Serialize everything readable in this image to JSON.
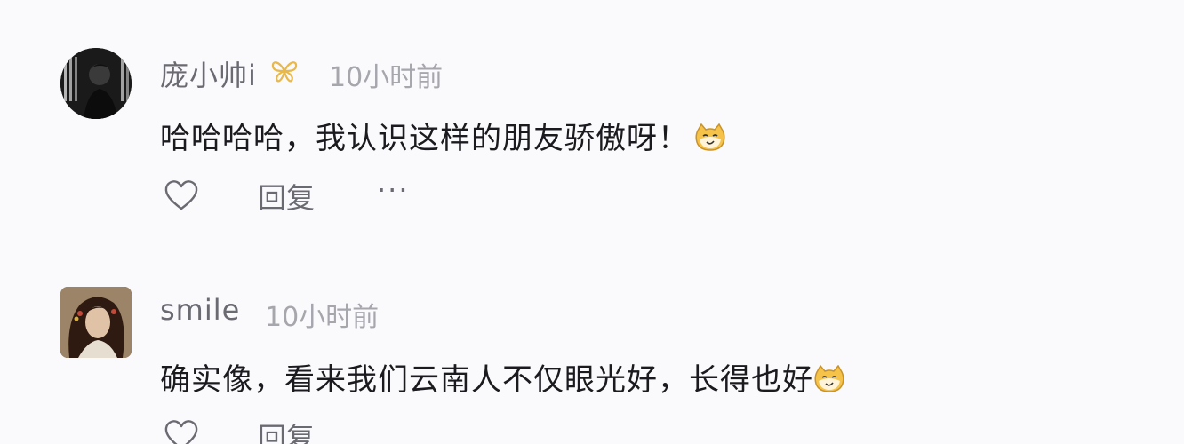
{
  "comments": [
    {
      "username": "庞小帅i",
      "badge_icon": "butterfly-badge-icon",
      "time": "10小时前",
      "text": "哈哈哈哈，我认识这样的朋友骄傲呀！",
      "emoji_icon": "cat-emoji-icon",
      "actions": {
        "like_icon": "heart-icon",
        "reply_label": "回复",
        "more_label": "···"
      }
    },
    {
      "username": "smile",
      "time": "10小时前",
      "text": "确实像，看来我们云南人不仅眼光好，长得也好",
      "emoji_icon": "cat-emoji-icon",
      "actions": {
        "like_icon": "heart-icon",
        "reply_label": "回复"
      }
    }
  ],
  "colors": {
    "background": "#fafafc",
    "username": "#6a6a72",
    "time": "#a6a6ad",
    "text": "#1b1b1f",
    "badge": "#e8b84a",
    "emoji": "#f5c24a"
  }
}
